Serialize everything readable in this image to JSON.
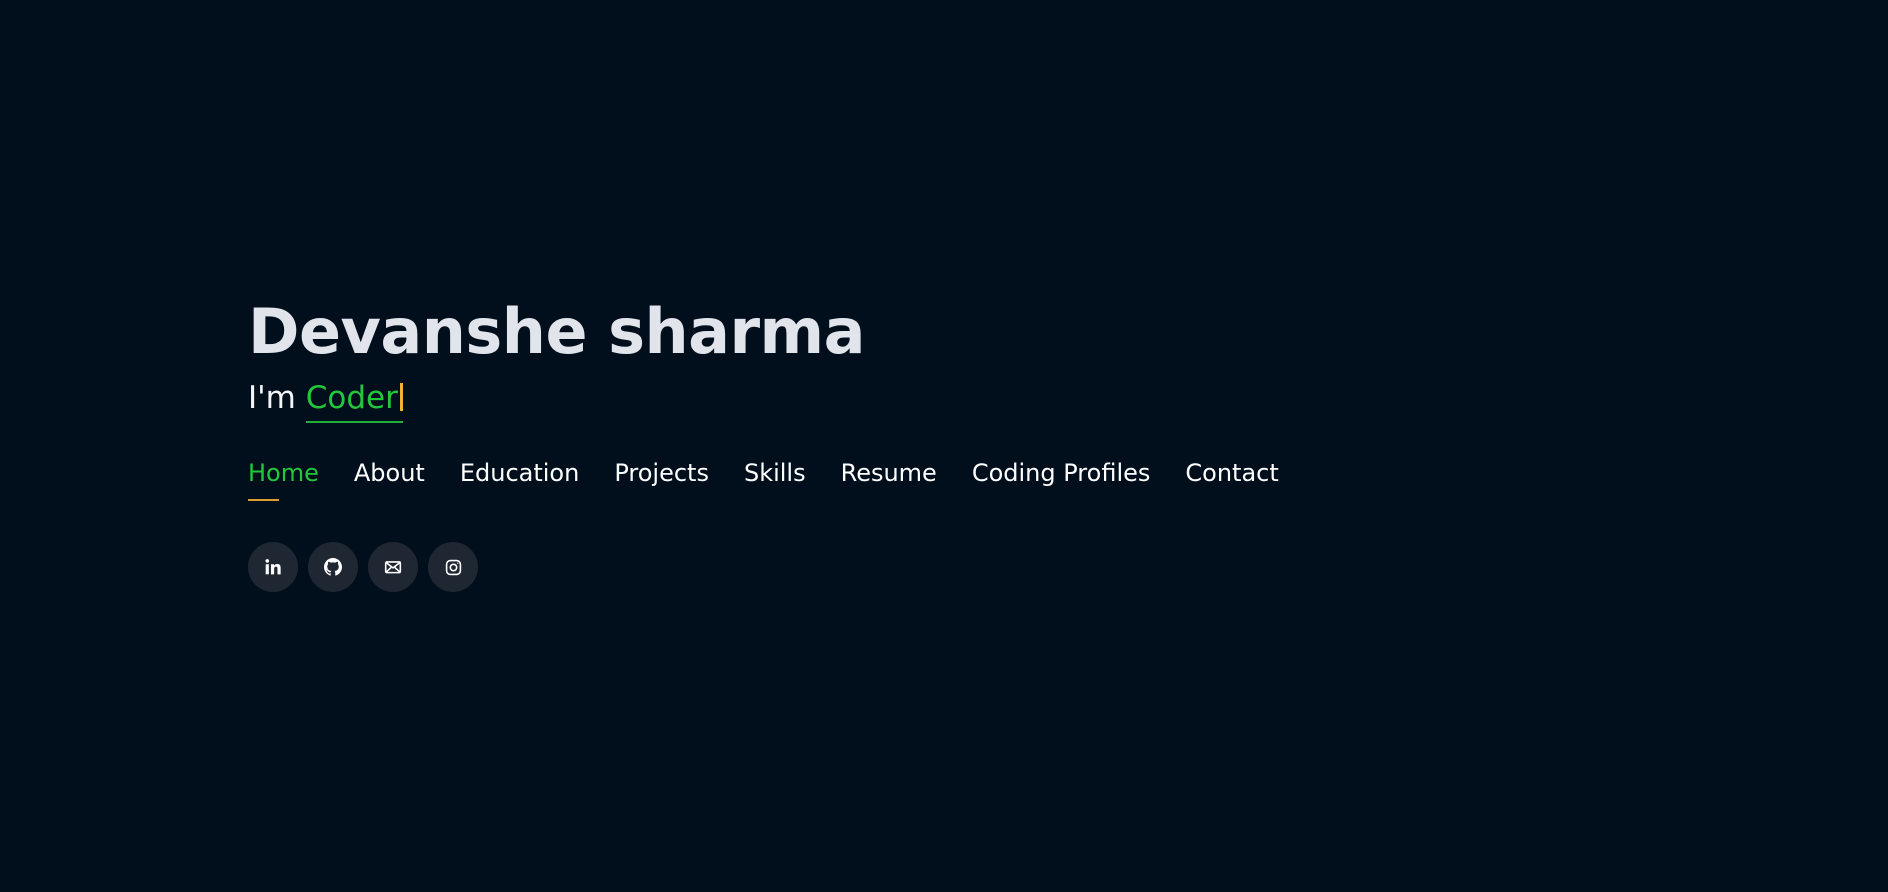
{
  "hero": {
    "name": "Devanshe sharma",
    "tagline_prefix": "I'm",
    "role": "Coder"
  },
  "nav": {
    "items": [
      {
        "label": "Home"
      },
      {
        "label": "About"
      },
      {
        "label": "Education"
      },
      {
        "label": "Projects"
      },
      {
        "label": "Skills"
      },
      {
        "label": "Resume"
      },
      {
        "label": "Coding Profiles"
      },
      {
        "label": "Contact"
      }
    ],
    "active": "Home"
  },
  "social": {
    "icons": [
      "linkedin-icon",
      "github-icon",
      "mail-icon",
      "instagram-icon"
    ]
  },
  "colors": {
    "background": "#010f1d",
    "accent": "#22c73c",
    "active_underline": "#d9a030",
    "cursor": "#f2b233",
    "name": "#e1e4ea",
    "button_background": "#1f2732"
  }
}
